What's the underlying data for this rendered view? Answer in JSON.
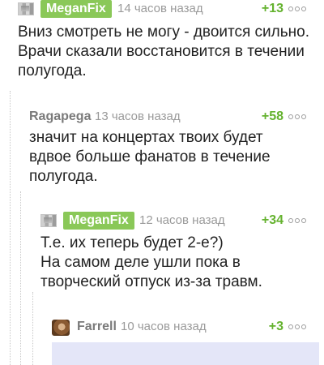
{
  "comments": [
    {
      "user": "MeganFix",
      "time": "14 часов назад",
      "rating": "+13",
      "lines": [
        "Вниз смотреть не могу - двоится сильно.",
        "Врачи сказали восстановится в течении",
        "полугода."
      ]
    },
    {
      "user": "Ragapega",
      "time": "13 часов назад",
      "rating": "+58",
      "lines": [
        "значит на концертах твоих будет",
        "вдвое больше фанатов в течение",
        "полугода."
      ]
    },
    {
      "user": "MeganFix",
      "time": "12 часов назад",
      "rating": "+34",
      "lines": [
        "Т.е. их теперь будет 2-е?)",
        "На самом деле ушли пока в",
        "творческий отпуск из-за травм."
      ]
    },
    {
      "user": "Farrell",
      "time": "10 часов назад",
      "rating": "+3",
      "lines": []
    }
  ],
  "icons": {
    "avatar_pixel": "pixelated-avatar-icon",
    "avatar_monkey": "monkey-avatar-icon",
    "more": "more-dots-icon"
  },
  "colors": {
    "author_tag": "#8ac858",
    "rating": "#64b22e",
    "meta": "#9a9a9a",
    "attachment": "#e4e6f8"
  }
}
